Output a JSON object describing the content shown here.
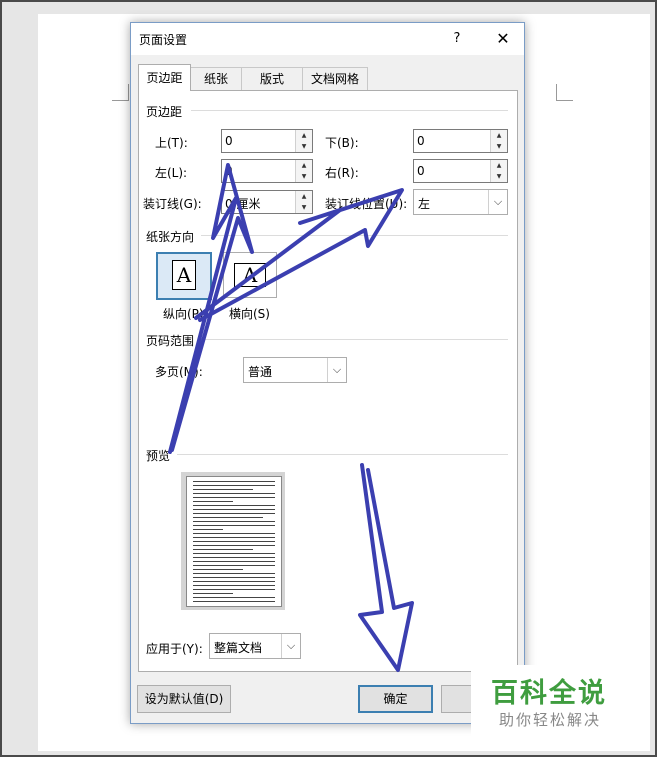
{
  "dialog": {
    "title": "页面设置",
    "help_glyph": "?",
    "close_glyph": "✕"
  },
  "tabs": [
    {
      "label": "页边距",
      "active": true
    },
    {
      "label": "纸张",
      "active": false
    },
    {
      "label": "版式",
      "active": false
    },
    {
      "label": "文档网格",
      "active": false
    }
  ],
  "margins": {
    "section_label": "页边距",
    "top_label": "上(T):",
    "top_value": "0",
    "bottom_label": "下(B):",
    "bottom_value": "0",
    "left_label": "左(L):",
    "left_value": "0",
    "right_label": "右(R):",
    "right_value": "0",
    "gutter_label": "装订线(G):",
    "gutter_value": "0 厘米",
    "gutter_pos_label": "装订线位置(U):",
    "gutter_pos_value": "左"
  },
  "orientation": {
    "section_label": "纸张方向",
    "portrait_label": "纵向(P)",
    "landscape_label": "横向(S)",
    "glyph": "A",
    "selected": "portrait"
  },
  "pages": {
    "section_label": "页码范围",
    "multiple_label": "多页(M):",
    "multiple_value": "普通"
  },
  "preview": {
    "section_label": "预览",
    "apply_label": "应用于(Y):",
    "apply_value": "整篇文档"
  },
  "buttons": {
    "set_default": "设为默认值(D)",
    "ok": "确定",
    "cancel_partial": "取"
  },
  "watermark": {
    "title": "百科全说",
    "subtitle": "助你轻松解决"
  },
  "colors": {
    "arrow": "#3b3fb0",
    "selection": "#3c7fb1",
    "watermark_green": "#3f9d3f"
  },
  "dropdown_glyph": "⌵",
  "spin_up_glyph": "▲",
  "spin_down_glyph": "▼"
}
